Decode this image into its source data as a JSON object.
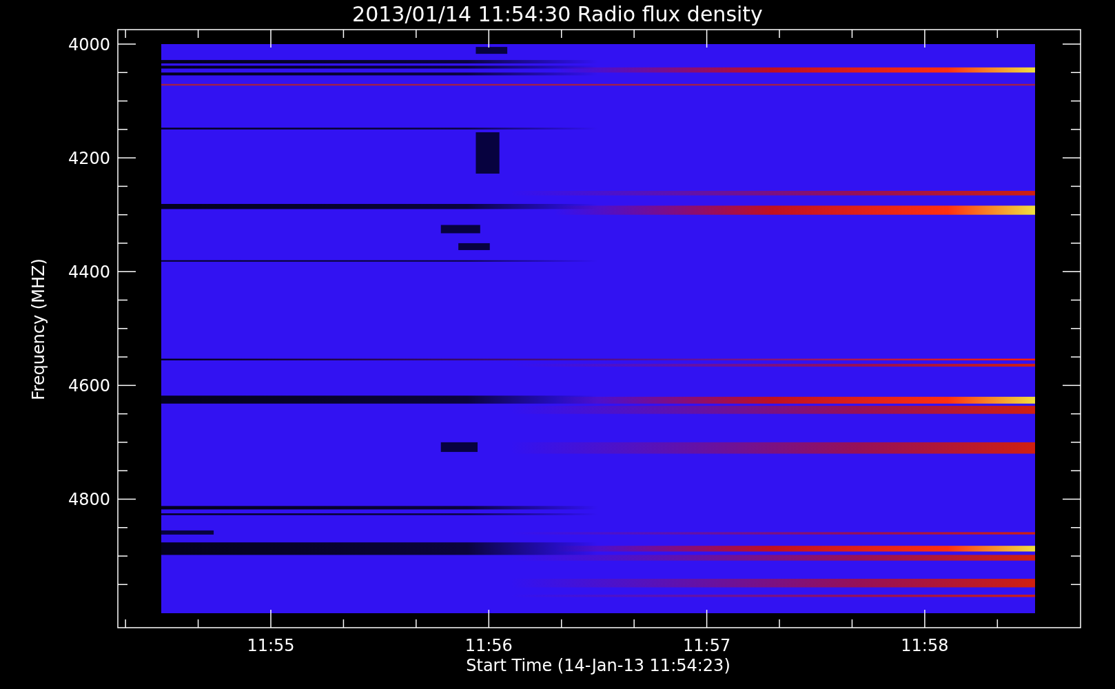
{
  "plot": {
    "title": "2013/01/14 11:54:30 Radio flux density",
    "y_axis": {
      "label": "Frequency (MHZ)",
      "ticks": [
        "4000",
        "4200",
        "4400",
        "4600",
        "4800"
      ]
    },
    "x_axis": {
      "label": "Start Time (14-Jan-13 11:54:23)",
      "ticks": [
        "11:55",
        "11:56",
        "11:57",
        "11:58"
      ]
    }
  }
}
